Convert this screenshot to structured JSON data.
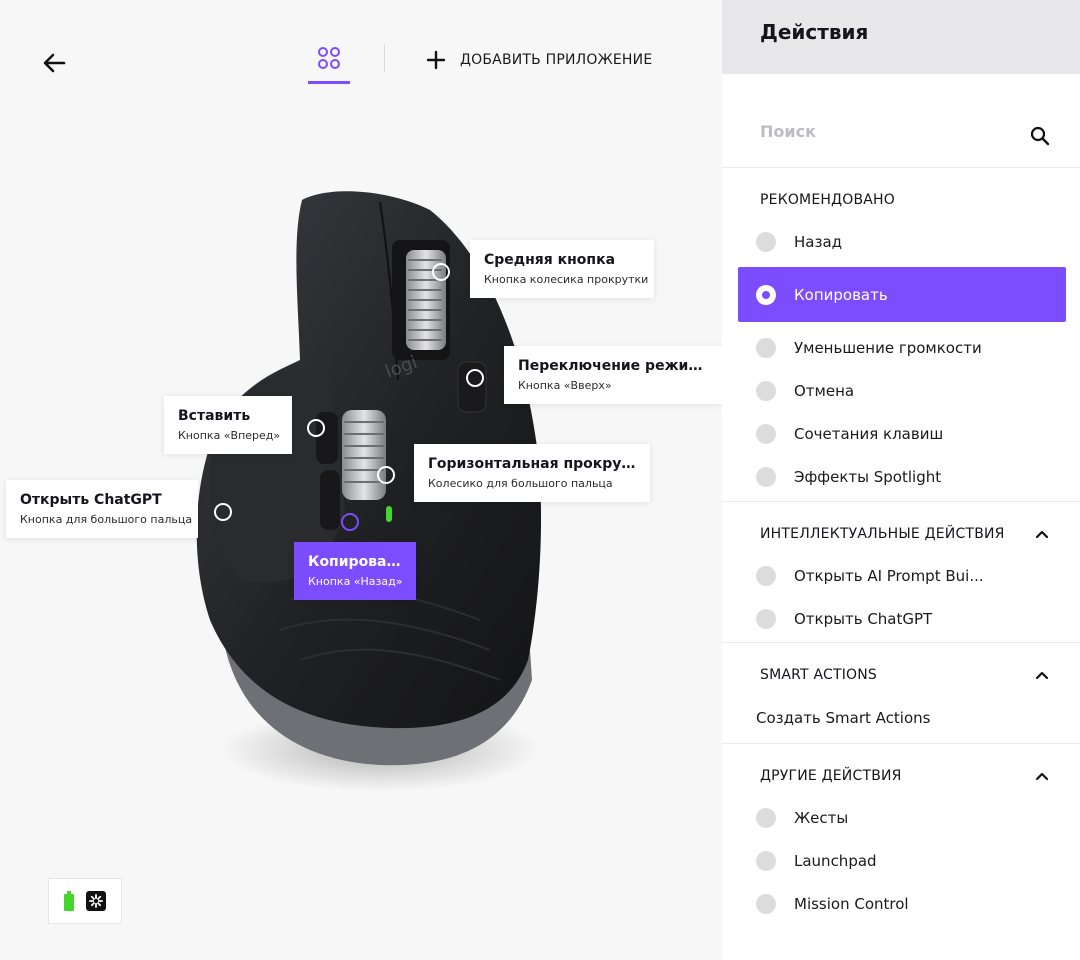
{
  "header": {
    "back_icon": "arrow-left-icon",
    "apps_icon": "app-grid-icon",
    "add_app_icon": "plus-icon",
    "add_app_label": "ДОБАВИТЬ ПРИЛОЖЕНИЕ",
    "accent": "#7c4dff"
  },
  "mouse": {
    "brand": "logi"
  },
  "callouts": {
    "middle": {
      "title": "Средняя кнопка",
      "subtitle": "Кнопка колесика прокрутки"
    },
    "mode": {
      "title": "Переключение режима к...",
      "subtitle": "Кнопка «Вверх»"
    },
    "paste": {
      "title": "Вставить",
      "subtitle": "Кнопка «Вперед»"
    },
    "hscroll": {
      "title": "Горизонтальная прокрутка",
      "subtitle": "Колесико для большого пальца"
    },
    "chatgpt": {
      "title": "Открыть ChatGPT",
      "subtitle": "Кнопка для большого пальца"
    },
    "copy": {
      "title": "Копировать",
      "subtitle": "Кнопка «Назад»"
    }
  },
  "device_status": {
    "battery_icon": "battery-icon",
    "connection_icon": "logi-bolt-receiver-icon",
    "battery_color": "#44d62c"
  },
  "panel": {
    "title": "Действия",
    "search_placeholder": "Поиск",
    "search_icon": "search-icon",
    "recommended": {
      "title": "РЕКОМЕНДОВАНО",
      "items": [
        "Назад",
        "Копировать",
        "Уменьшение громкости",
        "Отмена",
        "Сочетания клавиш",
        "Эффекты Spotlight"
      ],
      "selected": "Копировать"
    },
    "intelligent": {
      "title": "ИНТЕЛЛЕКТУАЛЬНЫЕ ДЕЙСТВИЯ",
      "items": [
        "Открыть AI Prompt Bui...",
        "Открыть ChatGPT"
      ]
    },
    "smart": {
      "title": "SMART ACTIONS",
      "link": "Создать Smart Actions"
    },
    "other": {
      "title": "ДРУГИЕ ДЕЙСТВИЯ",
      "items": [
        "Жесты",
        "Launchpad",
        "Mission Control"
      ]
    }
  }
}
